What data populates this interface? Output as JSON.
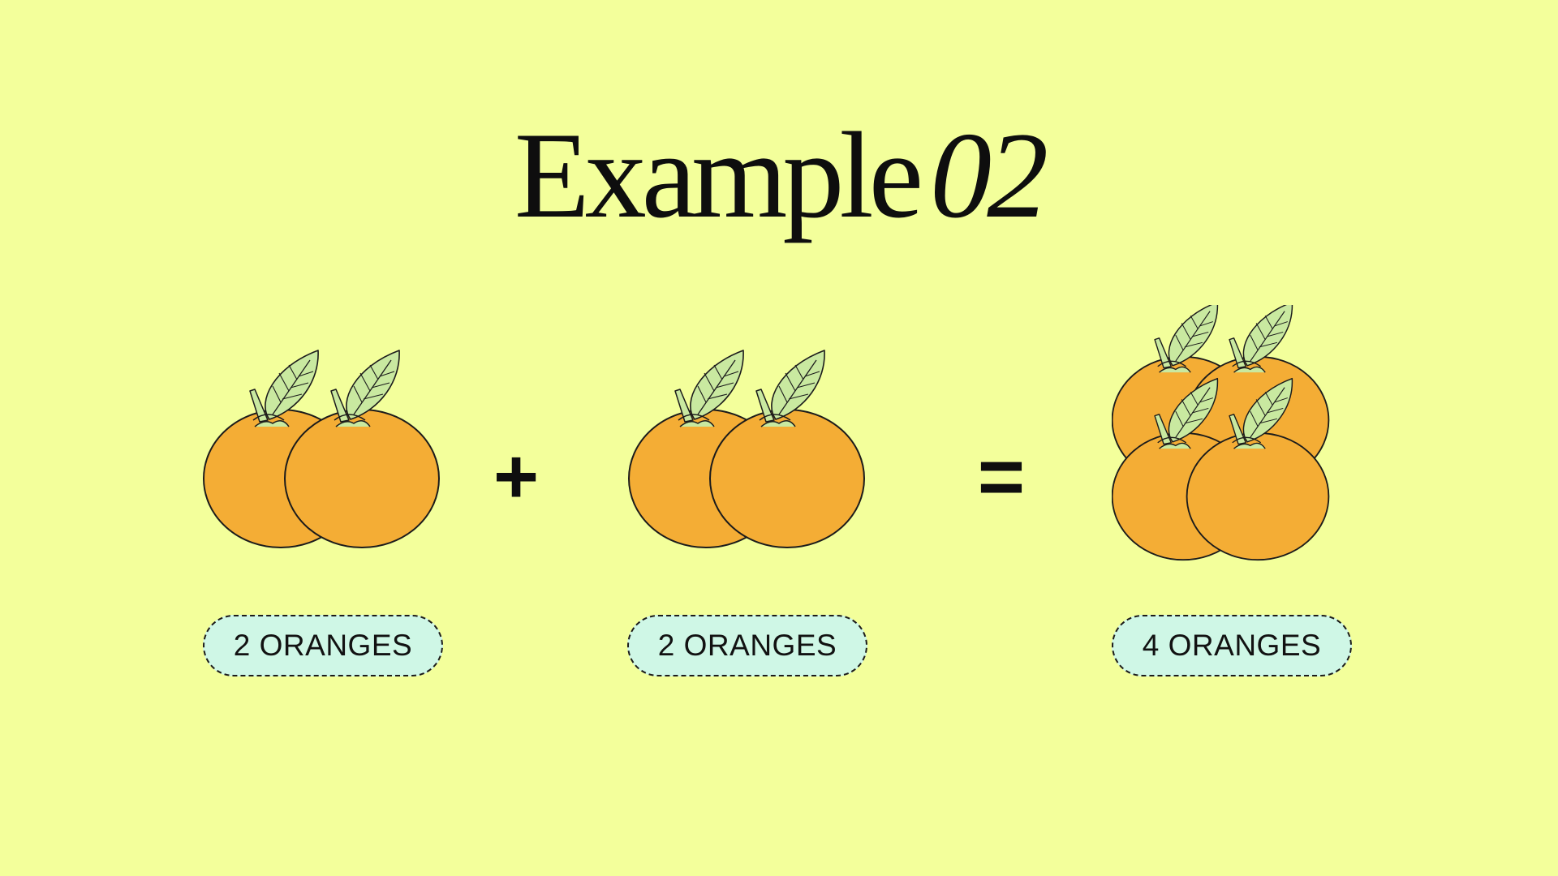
{
  "title": {
    "main": "Example",
    "number": "02"
  },
  "equation": {
    "operand_a": {
      "count": 2,
      "label": "2 ORANGES"
    },
    "plus_symbol": "+",
    "operand_b": {
      "count": 2,
      "label": "2 ORANGES"
    },
    "equals_symbol": "=",
    "result": {
      "count": 4,
      "label": "4 ORANGES"
    }
  },
  "icons": {
    "item": "orange-icon"
  },
  "colors": {
    "background": "#f3ff9b",
    "orange_fill": "#f4ad35",
    "leaf_fill": "#c9e9a0",
    "pill_fill": "#cff7e6",
    "outline": "#1b1b1b"
  }
}
